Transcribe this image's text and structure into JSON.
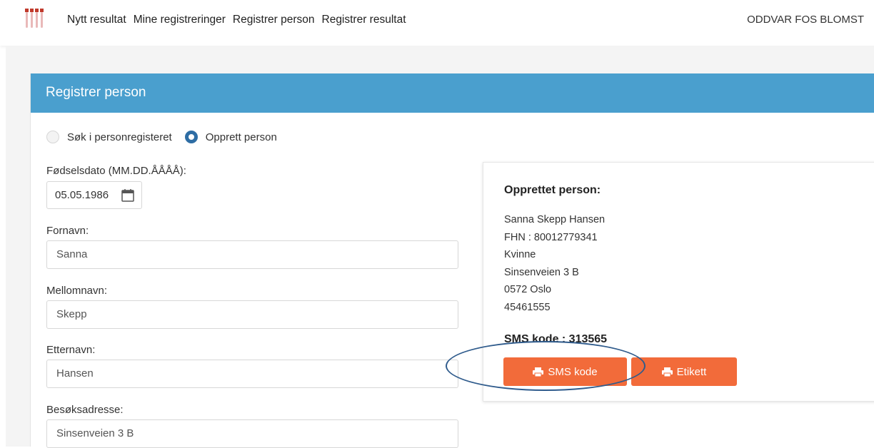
{
  "nav": {
    "items": [
      "Nytt resultat",
      "Mine registreringer",
      "Registrer person",
      "Registrer resultat"
    ],
    "user": "ODDVAR FOS BLOMST",
    "logo_icon": "test-tubes-icon"
  },
  "card": {
    "title": "Registrer person",
    "radio_search": "Søk i personregisteret",
    "radio_create": "Opprett person",
    "selected_radio": "create"
  },
  "form": {
    "birth_label": "Fødselsdato (MM.DD.ÅÅÅÅ):",
    "birth_value": "05.05.1986",
    "first_label": "Fornavn:",
    "first_value": "Sanna",
    "middle_label": "Mellomnavn:",
    "middle_value": "Skepp",
    "last_label": "Etternavn:",
    "last_value": "Hansen",
    "address_label": "Besøksadresse:",
    "address_value": "Sinsenveien 3 B"
  },
  "result": {
    "title": "Opprettet person:",
    "name": "Sanna Skepp Hansen",
    "fhn": "FHN : 80012779341",
    "gender": "Kvinne",
    "street": "Sinsenveien 3 B",
    "postal": "0572 Oslo",
    "phone": "45461555",
    "sms_code": "SMS kode : 313565",
    "btn_sms": "SMS kode",
    "btn_label": "Etikett"
  },
  "colors": {
    "header": "#4a9fce",
    "button": "#f26b3a",
    "radio_checked": "#2e6da4",
    "highlight_ring": "#2f5b8c"
  }
}
